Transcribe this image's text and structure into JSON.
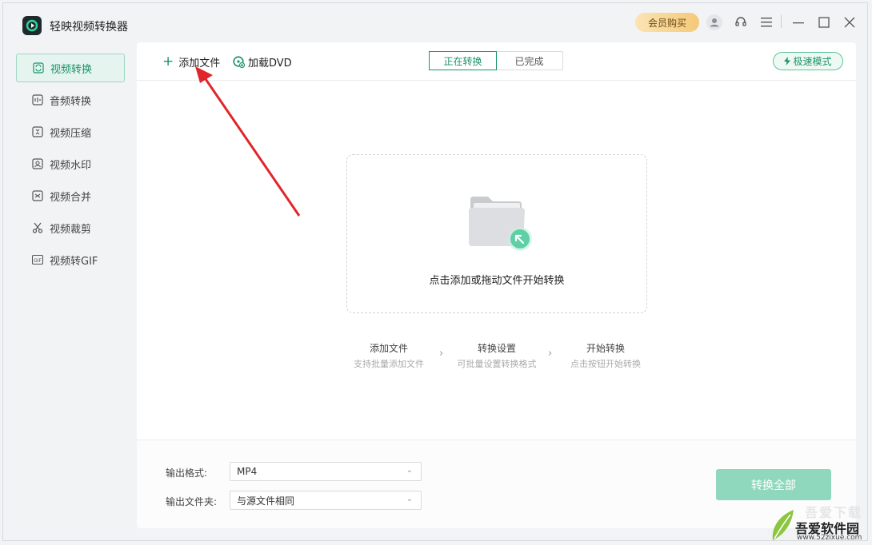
{
  "app": {
    "title": "轻映视频转换器",
    "vip_label": "会员购买"
  },
  "sidebar": {
    "items": [
      {
        "label": "视频转换",
        "icon": "convert-icon",
        "active": true
      },
      {
        "label": "音频转换",
        "icon": "audio-icon",
        "active": false
      },
      {
        "label": "视频压缩",
        "icon": "compress-icon",
        "active": false
      },
      {
        "label": "视频水印",
        "icon": "watermark-icon",
        "active": false
      },
      {
        "label": "视频合并",
        "icon": "merge-icon",
        "active": false
      },
      {
        "label": "视频裁剪",
        "icon": "scissors-icon",
        "active": false
      },
      {
        "label": "视频转GIF",
        "icon": "gif-icon",
        "active": false
      }
    ]
  },
  "toolbar": {
    "add_file": "添加文件",
    "load_dvd": "加载DVD",
    "tabs": [
      "正在转换",
      "已完成"
    ],
    "speed_mode": "极速模式"
  },
  "drop_zone": {
    "text": "点击添加或拖动文件开始转换"
  },
  "steps": [
    {
      "title": "添加文件",
      "sub": "支持批量添加文件"
    },
    {
      "title": "转换设置",
      "sub": "可批量设置转换格式"
    },
    {
      "title": "开始转换",
      "sub": "点击按钮开始转换"
    }
  ],
  "output": {
    "format_label": "输出格式:",
    "format_value": "MP4",
    "folder_label": "输出文件夹:",
    "folder_value": "与源文件相同",
    "convert_all": "转换全部"
  },
  "watermark": {
    "name": "吾爱软件园",
    "url": "www.52zixue.com",
    "brand": "吾爱下载"
  },
  "colors": {
    "accent": "#17936a",
    "accent_light": "#8fd8bd",
    "vip": "#f4c979",
    "annotation_arrow": "#e0262b"
  }
}
